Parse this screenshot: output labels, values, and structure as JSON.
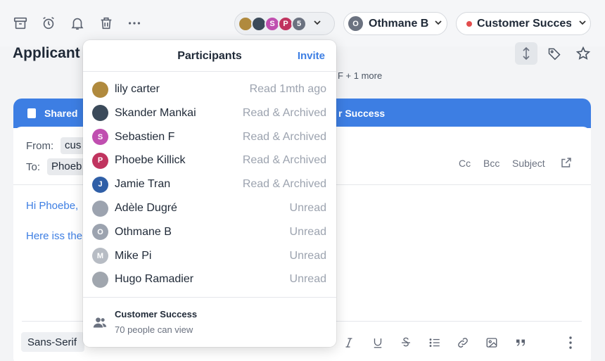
{
  "toolbar": {
    "icons": [
      "archive-icon",
      "alarm-clock-icon",
      "bell-icon",
      "trash-icon",
      "more-horizontal-icon"
    ],
    "participants_overflow": "5",
    "avatars": [
      {
        "initial": "",
        "color": "#b08a3e"
      },
      {
        "initial": "",
        "color": "#3b4a5a"
      },
      {
        "initial": "S",
        "color": "#c04fb0"
      },
      {
        "initial": "P",
        "color": "#c0345f"
      }
    ]
  },
  "user_pill": {
    "initial": "O",
    "name": "Othmane B"
  },
  "team_pill": {
    "name": "Customer Success",
    "dot_color": "#e24c4c"
  },
  "page": {
    "title": "Applicant",
    "subline": "F + 1 more"
  },
  "compose": {
    "header": "Shared",
    "header_team": "r Success",
    "from_label": "From:",
    "from_value": "cus",
    "to_label": "To:",
    "to_value": "Phoeb",
    "cc": "Cc",
    "bcc": "Bcc",
    "subject": "Subject",
    "line1": "Hi Phoebe,",
    "line2": "Here iss the",
    "font": "Sans-Serif"
  },
  "participants": {
    "title": "Participants",
    "invite": "Invite",
    "list": [
      {
        "name": "lily carter",
        "status": "Read 1mth ago",
        "initial": "",
        "color": "#b08a3e"
      },
      {
        "name": "Skander Mankai",
        "status": "Read & Archived",
        "initial": "",
        "color": "#3b4a5a"
      },
      {
        "name": "Sebastien F",
        "status": "Read & Archived",
        "initial": "S",
        "color": "#c04fb0"
      },
      {
        "name": "Phoebe Killick",
        "status": "Read & Archived",
        "initial": "P",
        "color": "#c0345f"
      },
      {
        "name": "Jamie Tran",
        "status": "Read & Archived",
        "initial": "J",
        "color": "#2f5fa7"
      },
      {
        "name": "Adèle Dugré",
        "status": "Unread",
        "initial": "",
        "color": "#9ca3af"
      },
      {
        "name": "Othmane B",
        "status": "Unread",
        "initial": "O",
        "color": "#9ca3af"
      },
      {
        "name": "Mike Pi",
        "status": "Unread",
        "initial": "M",
        "color": "#b7bcc4"
      },
      {
        "name": "Hugo Ramadier",
        "status": "Unread",
        "initial": "",
        "color": "#a0a6ae"
      }
    ],
    "group": {
      "name": "Customer Success",
      "sub": "70 people can view"
    }
  }
}
